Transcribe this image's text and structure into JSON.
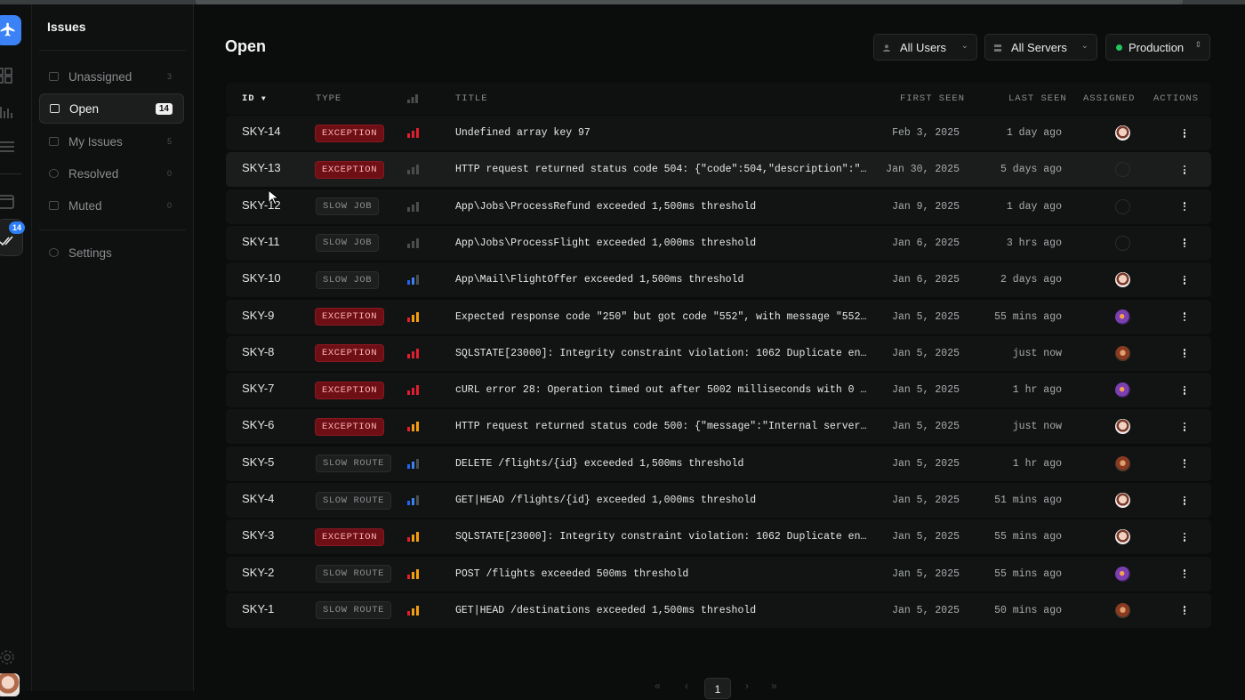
{
  "sidebar": {
    "title": "Issues",
    "items": [
      {
        "label": "Unassigned",
        "count": "3"
      },
      {
        "label": "Open",
        "count": "14"
      },
      {
        "label": "My Issues",
        "count": "5"
      },
      {
        "label": "Resolved",
        "count": "0"
      },
      {
        "label": "Muted",
        "count": "0"
      }
    ],
    "settings_label": "Settings"
  },
  "rail": {
    "badge": "14"
  },
  "page": {
    "title": "Open"
  },
  "filters": {
    "users": "All Users",
    "servers": "All Servers",
    "environment": "Production"
  },
  "colors": {
    "exception": "#6e0f16",
    "accent": "#2d7ff9",
    "production_dot": "#22c55e"
  },
  "table": {
    "headers": {
      "id": "ID",
      "type": "TYPE",
      "title": "TITLE",
      "first_seen": "FIRST SEEN",
      "last_seen": "LAST SEEN",
      "assigned": "ASSIGNED",
      "actions": "ACTIONS"
    },
    "rows": [
      {
        "id": "SKY-14",
        "type": "EXCEPTION",
        "title": "Undefined array key 97",
        "first_seen": "Feb 3, 2025",
        "last_seen": "1 day ago",
        "priority": "high",
        "assignee": "f1"
      },
      {
        "id": "SKY-13",
        "type": "EXCEPTION",
        "title": "HTTP request returned status code 504: {\"code\":504,\"description\":\"…",
        "first_seen": "Jan 30, 2025",
        "last_seen": "5 days ago",
        "priority": "none",
        "assignee": "none"
      },
      {
        "id": "SKY-12",
        "type": "SLOW JOB",
        "title": "App\\Jobs\\ProcessRefund exceeded 1,500ms threshold",
        "first_seen": "Jan 9, 2025",
        "last_seen": "1 day ago",
        "priority": "none",
        "assignee": "none"
      },
      {
        "id": "SKY-11",
        "type": "SLOW JOB",
        "title": "App\\Jobs\\ProcessFlight exceeded 1,000ms threshold",
        "first_seen": "Jan 6, 2025",
        "last_seen": "3 hrs ago",
        "priority": "none",
        "assignee": "none"
      },
      {
        "id": "SKY-10",
        "type": "SLOW JOB",
        "title": "App\\Mail\\FlightOffer exceeded 1,500ms threshold",
        "first_seen": "Jan 6, 2025",
        "last_seen": "2 days ago",
        "priority": "low",
        "assignee": "f1"
      },
      {
        "id": "SKY-9",
        "type": "EXCEPTION",
        "title": "Expected response code \"250\" but got code \"552\", with message \"552…",
        "first_seen": "Jan 5, 2025",
        "last_seen": "55 mins ago",
        "priority": "medium",
        "assignee": "p"
      },
      {
        "id": "SKY-8",
        "type": "EXCEPTION",
        "title": "SQLSTATE[23000]: Integrity constraint violation: 1062 Duplicate en…",
        "first_seen": "Jan 5, 2025",
        "last_seen": "just now",
        "priority": "high",
        "assignee": "b"
      },
      {
        "id": "SKY-7",
        "type": "EXCEPTION",
        "title": "cURL error 28: Operation timed out after 5002 milliseconds with 0 …",
        "first_seen": "Jan 5, 2025",
        "last_seen": "1 hr ago",
        "priority": "high",
        "assignee": "p"
      },
      {
        "id": "SKY-6",
        "type": "EXCEPTION",
        "title": "HTTP request returned status code 500: {\"message\":\"Internal server…",
        "first_seen": "Jan 5, 2025",
        "last_seen": "just now",
        "priority": "medium",
        "assignee": "f1"
      },
      {
        "id": "SKY-5",
        "type": "SLOW ROUTE",
        "title": "DELETE /flights/{id} exceeded 1,500ms threshold",
        "first_seen": "Jan 5, 2025",
        "last_seen": "1 hr ago",
        "priority": "low",
        "assignee": "b"
      },
      {
        "id": "SKY-4",
        "type": "SLOW ROUTE",
        "title": "GET|HEAD /flights/{id} exceeded 1,000ms threshold",
        "first_seen": "Jan 5, 2025",
        "last_seen": "51 mins ago",
        "priority": "low",
        "assignee": "f1"
      },
      {
        "id": "SKY-3",
        "type": "EXCEPTION",
        "title": "SQLSTATE[23000]: Integrity constraint violation: 1062 Duplicate en…",
        "first_seen": "Jan 5, 2025",
        "last_seen": "55 mins ago",
        "priority": "medium",
        "assignee": "f1"
      },
      {
        "id": "SKY-2",
        "type": "SLOW ROUTE",
        "title": "POST /flights exceeded 500ms threshold",
        "first_seen": "Jan 5, 2025",
        "last_seen": "55 mins ago",
        "priority": "medium",
        "assignee": "p"
      },
      {
        "id": "SKY-1",
        "type": "SLOW ROUTE",
        "title": "GET|HEAD /destinations exceeded 1,500ms threshold",
        "first_seen": "Jan 5, 2025",
        "last_seen": "50 mins ago",
        "priority": "medium",
        "assignee": "b"
      }
    ]
  },
  "pagination": {
    "current": "1"
  }
}
